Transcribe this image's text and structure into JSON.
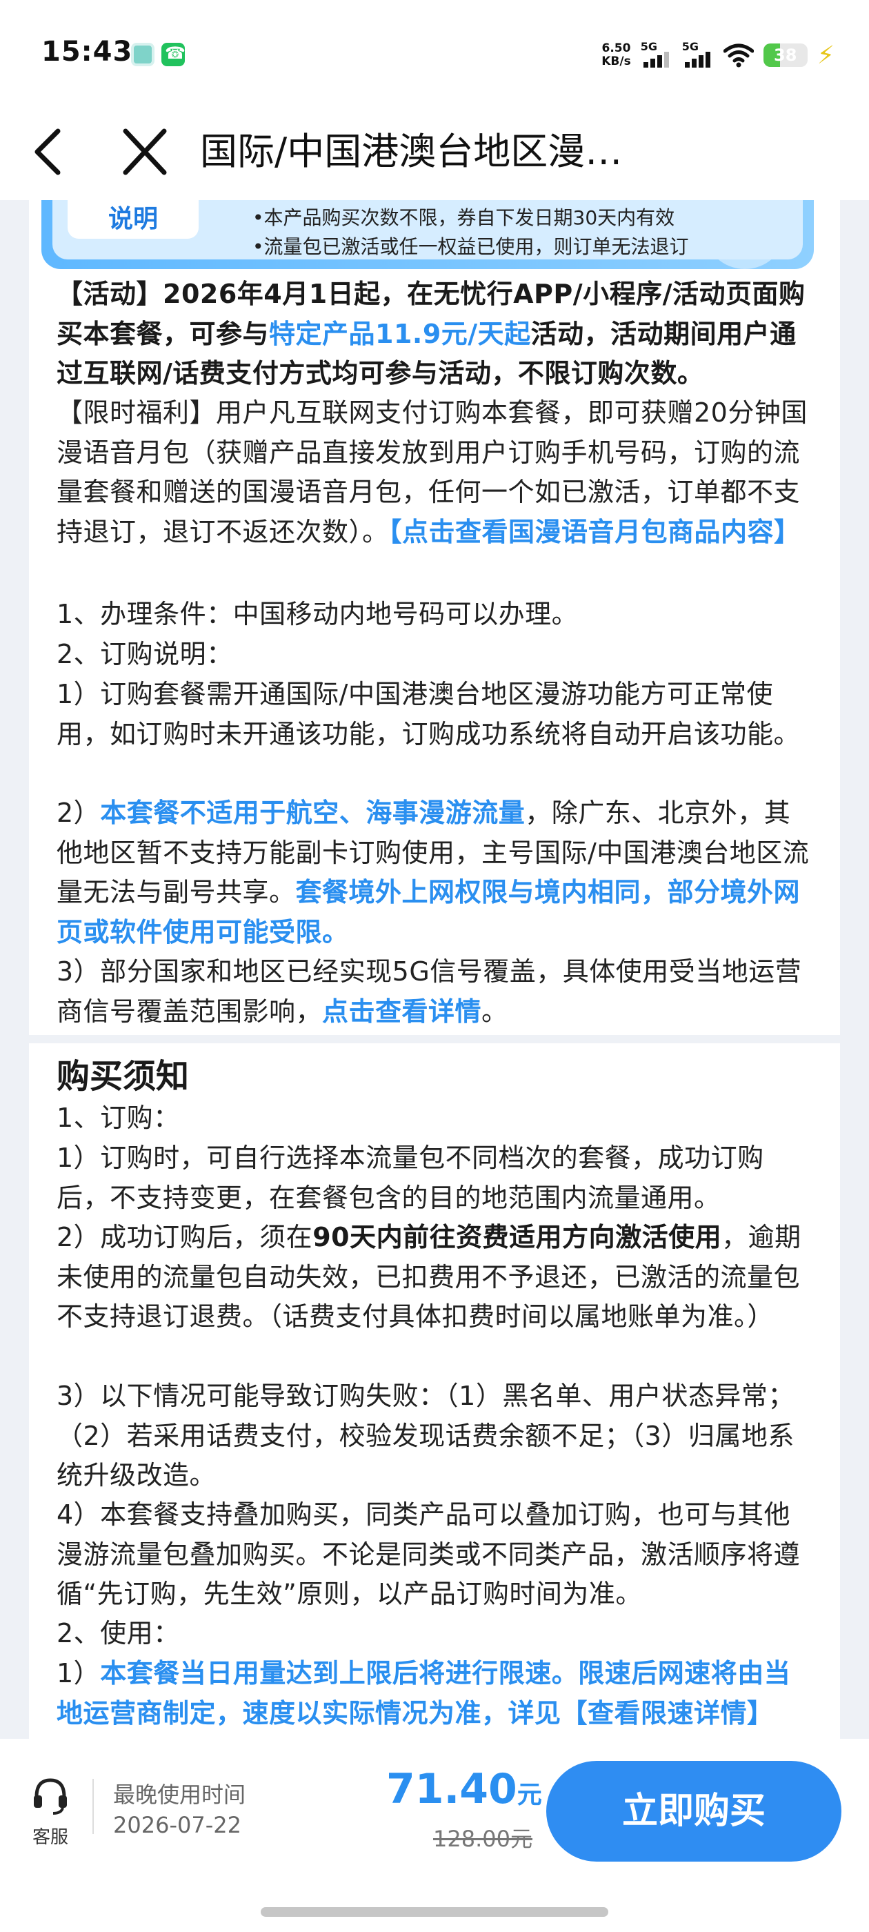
{
  "status_bar": {
    "time": "15:43",
    "net_speed_value": "6.50",
    "net_speed_unit": "KB/s",
    "signal_1_tag": "5G",
    "signal_2_tag": "5G",
    "battery_level": "38",
    "battery_fraction": 0.38
  },
  "nav": {
    "title": "国际/中国港澳台地区漫…"
  },
  "explain_banner": {
    "tag": "说明",
    "lines": [
      "•本产品购买次数不限，券自下发日期30天内有效",
      "•流量包已激活或任一权益已使用，则订单无法退订"
    ]
  },
  "activity": {
    "part1": "【活动】2026年4月1日起，在无忧行APP/小程序/活动页面购买本套餐，可参与",
    "highlight": "特定产品11.9元/天起",
    "part2": "活动，活动期间用户通过互联网/话费支付方式均可参与活动，不限订购次数。"
  },
  "welfare": {
    "text": "【限时福利】用户凡互联网支付订购本套餐，即可获赠20分钟国漫语音月包（获赠产品直接发放到用户订购手机号码，订购的流量套餐和赠送的国漫语音月包，任何一个如已激活，订单都不支持退订，退订不返还次数）。",
    "link": "【点击查看国漫语音月包商品内容】"
  },
  "conditions": {
    "item1": "1、办理条件：中国移动内地号码可以办理。",
    "item2": "2、订购说明：",
    "sub1": "1）订购套餐需开通国际/中国港澳台地区漫游功能方可正常使用，如订购时未开通该功能，订购成功系统将自动开启该功能。",
    "sub2_prefix": "2）",
    "sub2_highlight": "本套餐不适用于航空、海事漫游流量",
    "sub2_text": "，除广东、北京外，其他地区暂不支持万能副卡订购使用，主号国际/中国港澳台地区流量无法与副号共享。",
    "sub2_highlight2": "套餐境外上网权限与境内相同，部分境外网页或软件使用可能受限。",
    "sub3_text": "3）部分国家和地区已经实现5G信号覆盖，具体使用受当地运营商信号覆盖范围影响，",
    "sub3_link": "点击查看详情",
    "sub3_end": "。"
  },
  "notice": {
    "title": "购买须知",
    "h1": "1、订购：",
    "p1": "1）订购时，可自行选择本流量包不同档次的套餐，成功订购后，不支持变更，在套餐包含的目的地范围内流量通用。",
    "p2_prefix": "2）成功订购后，须在",
    "p2_bold": "90天内前往资费适用方向激活使用",
    "p2_text": "，逾期未使用的流量包自动失效，已扣费用不予退还，已激活的流量包不支持退订退费。（话费支付具体扣费时间以属地账单为准。）",
    "p3": "3）以下情况可能导致订购失败：（1）黑名单、用户状态异常；（2）若采用话费支付，校验发现话费余额不足；（3）归属地系统升级改造。",
    "p4": "4）本套餐支持叠加购买，同类产品可以叠加订购，也可与其他漫游流量包叠加购买。不论是同类或不同类产品，激活顺序将遵循“先订购，先生效”原则，以产品订购时间为准。",
    "h2": "2、使用：",
    "u1_prefix": "1）",
    "u1_highlight": "本套餐当日用量达到上限后将进行限速。限速后网速将由当地运营商制定，速度以实际情况为准，详见【查看限速详情】"
  },
  "bottom_bar": {
    "service_label": "客服",
    "deadline_label": "最晚使用时间",
    "deadline_value": "2026-07-22",
    "price": "71.40",
    "price_unit": "元",
    "original_price": "128.00元",
    "buy_label": "立即购买"
  },
  "colors": {
    "accent": "#2a8ff0",
    "button": "#2f8df2",
    "page_bg": "#eef1f6"
  }
}
